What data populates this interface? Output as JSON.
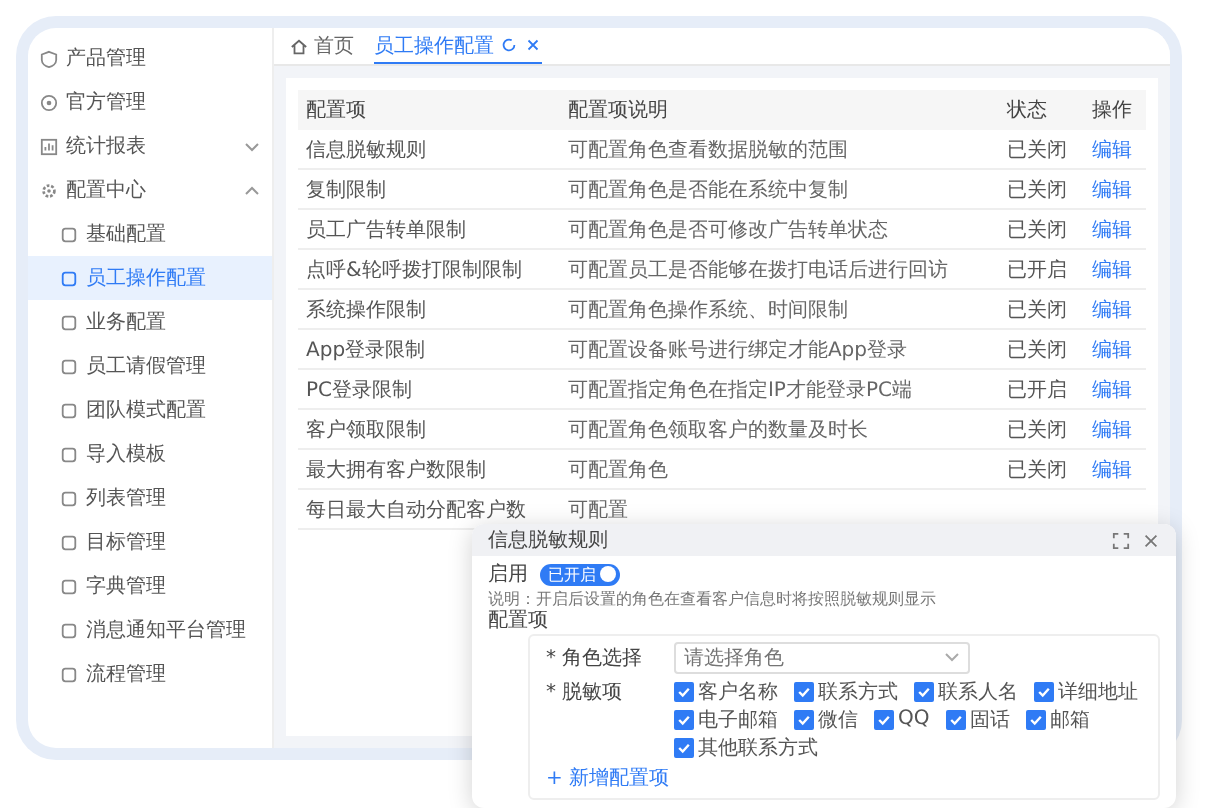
{
  "sidebar": {
    "items": [
      {
        "label": "产品管理"
      },
      {
        "label": "官方管理"
      },
      {
        "label": "统计报表",
        "expanded": false
      },
      {
        "label": "配置中心",
        "expanded": true,
        "children": [
          {
            "label": "基础配置",
            "selected": false
          },
          {
            "label": "员工操作配置",
            "selected": true
          },
          {
            "label": "业务配置",
            "selected": false
          },
          {
            "label": "员工请假管理",
            "selected": false
          },
          {
            "label": "团队模式配置",
            "selected": false
          },
          {
            "label": "导入模板",
            "selected": false
          },
          {
            "label": "列表管理",
            "selected": false
          },
          {
            "label": "目标管理",
            "selected": false
          },
          {
            "label": "字典管理",
            "selected": false
          },
          {
            "label": "消息通知平台管理",
            "selected": false
          },
          {
            "label": "流程管理",
            "selected": false
          }
        ]
      }
    ]
  },
  "tabs": [
    {
      "label": "首页",
      "selected": false,
      "kind": "home"
    },
    {
      "label": "员工操作配置",
      "selected": true,
      "kind": "page"
    }
  ],
  "table": {
    "columns": [
      "配置项",
      "配置项说明",
      "状态",
      "操作"
    ],
    "rows": [
      {
        "item": "信息脱敏规则",
        "description": "可配置角色查看数据脱敏的范围",
        "status": "已关闭",
        "action": "编辑"
      },
      {
        "item": "复制限制",
        "description": "可配置角色是否能在系统中复制",
        "status": "已关闭",
        "action": "编辑"
      },
      {
        "item": "员工广告转单限制",
        "description": "可配置角色是否可修改广告转单状态",
        "status": "已关闭",
        "action": "编辑"
      },
      {
        "item": "点呼&轮呼拨打限制限制",
        "description": "可配置员工是否能够在拨打电话后进行回访",
        "status": "已开启",
        "action": "编辑"
      },
      {
        "item": "系统操作限制",
        "description": "可配置角色操作系统、时间限制",
        "status": "已关闭",
        "action": "编辑"
      },
      {
        "item": "App登录限制",
        "description": "可配置设备账号进行绑定才能App登录",
        "status": "已关闭",
        "action": "编辑"
      },
      {
        "item": "PC登录限制",
        "description": "可配置指定角色在指定IP才能登录PC端",
        "status": "已开启",
        "action": "编辑"
      },
      {
        "item": "客户领取限制",
        "description": "可配置角色领取客户的数量及时长",
        "status": "已关闭",
        "action": "编辑"
      },
      {
        "item": "最大拥有客户数限制",
        "description": "可配置角色",
        "status": "已关闭",
        "action": "编辑"
      },
      {
        "item": "每日最大自动分配客户数",
        "description": "可配置"
      }
    ]
  },
  "modal": {
    "title": "信息脱敏规则",
    "toggle": {
      "label": "启用",
      "on": true,
      "text": "已开启"
    },
    "note": "说明：开启后设置的角色在查看客户信息时将按照脱敏规则显示",
    "section_label": "配置项",
    "role_field": {
      "label": "* 角色选择",
      "placeholder": "请选择角色"
    },
    "mask_label": "* 脱敏项",
    "options": [
      {
        "label": "客户名称",
        "checked": true
      },
      {
        "label": "联系方式",
        "checked": true
      },
      {
        "label": "联系人名",
        "checked": true
      },
      {
        "label": "详细地址",
        "checked": true
      },
      {
        "label": "电子邮箱",
        "checked": true
      },
      {
        "label": "微信",
        "checked": true
      },
      {
        "label": "QQ",
        "checked": true
      },
      {
        "label": "固话",
        "checked": true
      },
      {
        "label": "邮箱",
        "checked": true
      },
      {
        "label": "其他联系方式",
        "checked": true
      }
    ],
    "add_link": "+ 新增配置项"
  }
}
